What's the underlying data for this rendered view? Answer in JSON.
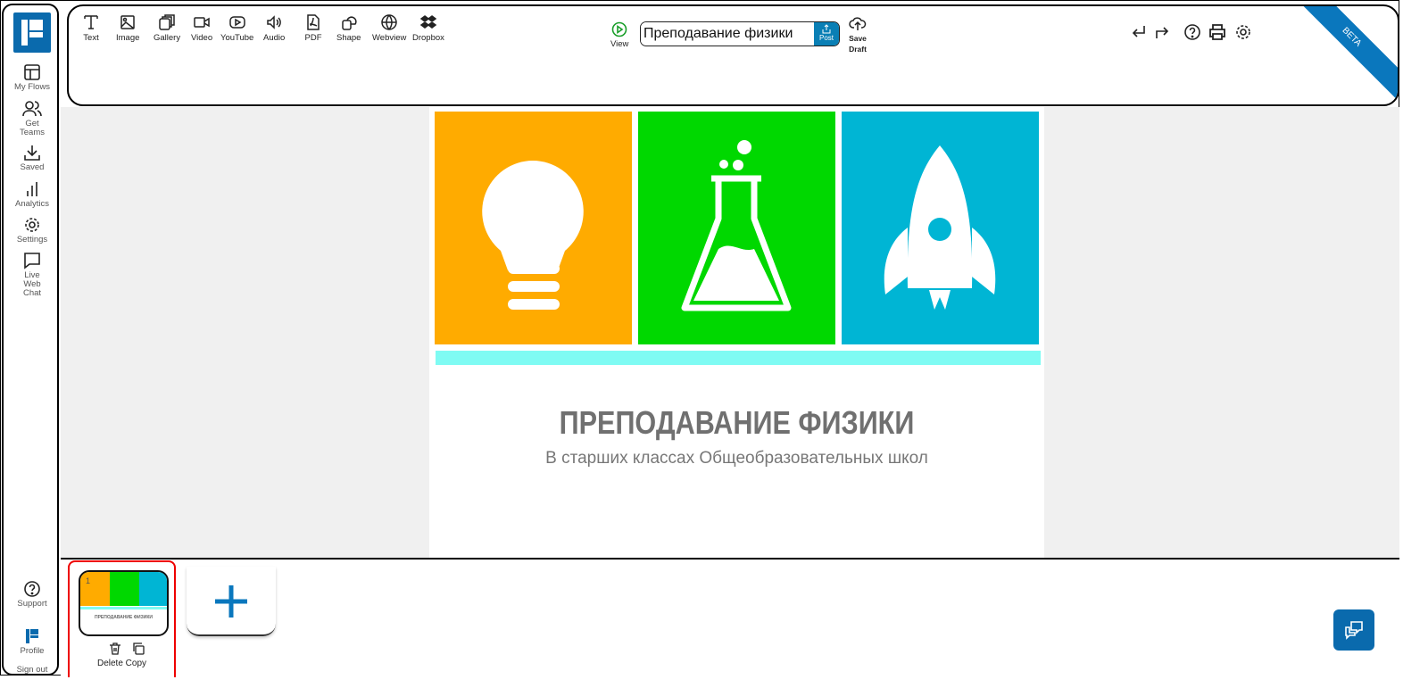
{
  "sidebar": {
    "items": [
      {
        "label": "My Flows",
        "icon": "layout-icon"
      },
      {
        "label": "Get Teams",
        "icon": "users-icon"
      },
      {
        "label": "Saved",
        "icon": "download-icon"
      },
      {
        "label": "Analytics",
        "icon": "bar-chart-icon"
      },
      {
        "label": "Settings",
        "icon": "gear-icon"
      },
      {
        "label": "Live Web Chat",
        "icon": "chat-icon"
      }
    ],
    "bottom": [
      {
        "label": "Support",
        "icon": "help-icon"
      },
      {
        "label": "Profile",
        "icon": "logo-icon"
      },
      {
        "label": "Sign out"
      }
    ]
  },
  "toolbar": {
    "tools": [
      "Text",
      "Image",
      "Gallery",
      "Video",
      "YouTube",
      "Audio",
      "PDF",
      "Shape",
      "Webview",
      "Dropbox"
    ],
    "view_label": "View",
    "title_value": "Преподавание физики",
    "post_label": "Post",
    "save_label": "Save",
    "draft_label": "Draft",
    "beta_label": "BETA"
  },
  "slide": {
    "title": "ПРЕПОДАВАНИЕ ФИЗИКИ",
    "subtitle": "В старших классах Общеобразовательных школ",
    "colors": {
      "orange": "#ffab00",
      "green": "#00d800",
      "blue": "#00b5d4",
      "cyan_bar": "#7ffbf3"
    }
  },
  "pages": {
    "items": [
      {
        "number": "1",
        "title": "ПРЕПОДАВАНИЕ ФИЗИКИ"
      }
    ],
    "delete_label": "Delete",
    "copy_label": "Copy"
  },
  "accent": "#0a77bd"
}
